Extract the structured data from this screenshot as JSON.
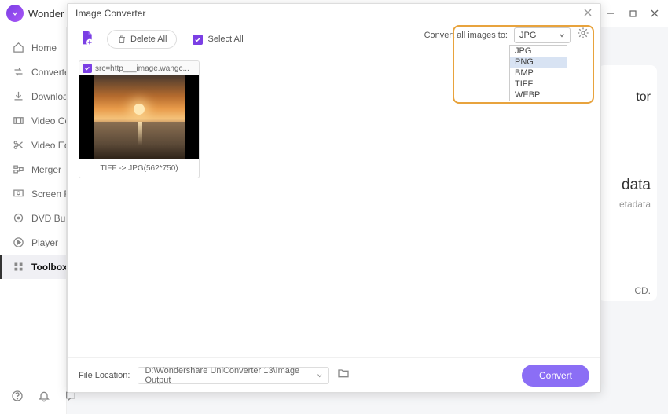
{
  "mainWindow": {
    "title": "Wonder"
  },
  "sidebar": {
    "items": [
      {
        "label": "Home"
      },
      {
        "label": "Converte"
      },
      {
        "label": "Downloa"
      },
      {
        "label": "Video Co"
      },
      {
        "label": "Video Ed"
      },
      {
        "label": "Merger"
      },
      {
        "label": "Screen R"
      },
      {
        "label": "DVD Bur"
      },
      {
        "label": "Player"
      },
      {
        "label": "Toolbox"
      }
    ]
  },
  "sideCard": {
    "line1": "tor",
    "line2": "data",
    "line3": "etadata",
    "line4": "CD."
  },
  "modal": {
    "title": "Image Converter",
    "toolbar": {
      "deleteAll": "Delete All",
      "selectAll": "Select All",
      "convertLabel": "Convert all images to:",
      "selectedFormat": "JPG",
      "formatOptions": [
        "JPG",
        "PNG",
        "BMP",
        "TIFF",
        "WEBP"
      ]
    },
    "thumb": {
      "filename": "src=http___image.wangc...",
      "caption": "TIFF -> JPG(562*750)"
    },
    "footer": {
      "locationLabel": "File Location:",
      "path": "D:\\Wondershare UniConverter 13\\Image Output",
      "convert": "Convert"
    }
  }
}
